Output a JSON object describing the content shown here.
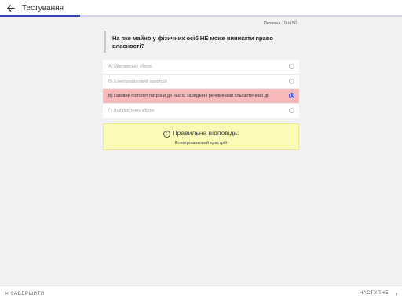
{
  "header": {
    "title": "Тестування",
    "back_icon": "arrow-left-icon",
    "progress_fraction": 0.2
  },
  "question": {
    "counter": "Питання 10 із 50",
    "text": "На яке майно у фізичних осіб НЕ може виникати право власності?"
  },
  "options": [
    {
      "label": "А) Мисливську зброю",
      "selected": false
    },
    {
      "label": "Б) Електрошоковий пристрій",
      "selected": false
    },
    {
      "label": "В) Газовий пістолет патрони до нього, заряджені речовинами сльозоточивої дії",
      "selected": true
    },
    {
      "label": "Г) Пневматичну зброю",
      "selected": false
    }
  ],
  "answer": {
    "title": "Правильна відповідь:",
    "text": "Електрошоковий пристрій",
    "icon": "info-icon"
  },
  "footer": {
    "finish_label": "ЗАВЕРШИТИ",
    "next_label": "НАСТУПНЕ"
  },
  "colors": {
    "accent": "#2e44b7",
    "selected_option": "#f7b9b9",
    "answer_bg": "#fbfbb7",
    "background": "#f2f2f5"
  }
}
